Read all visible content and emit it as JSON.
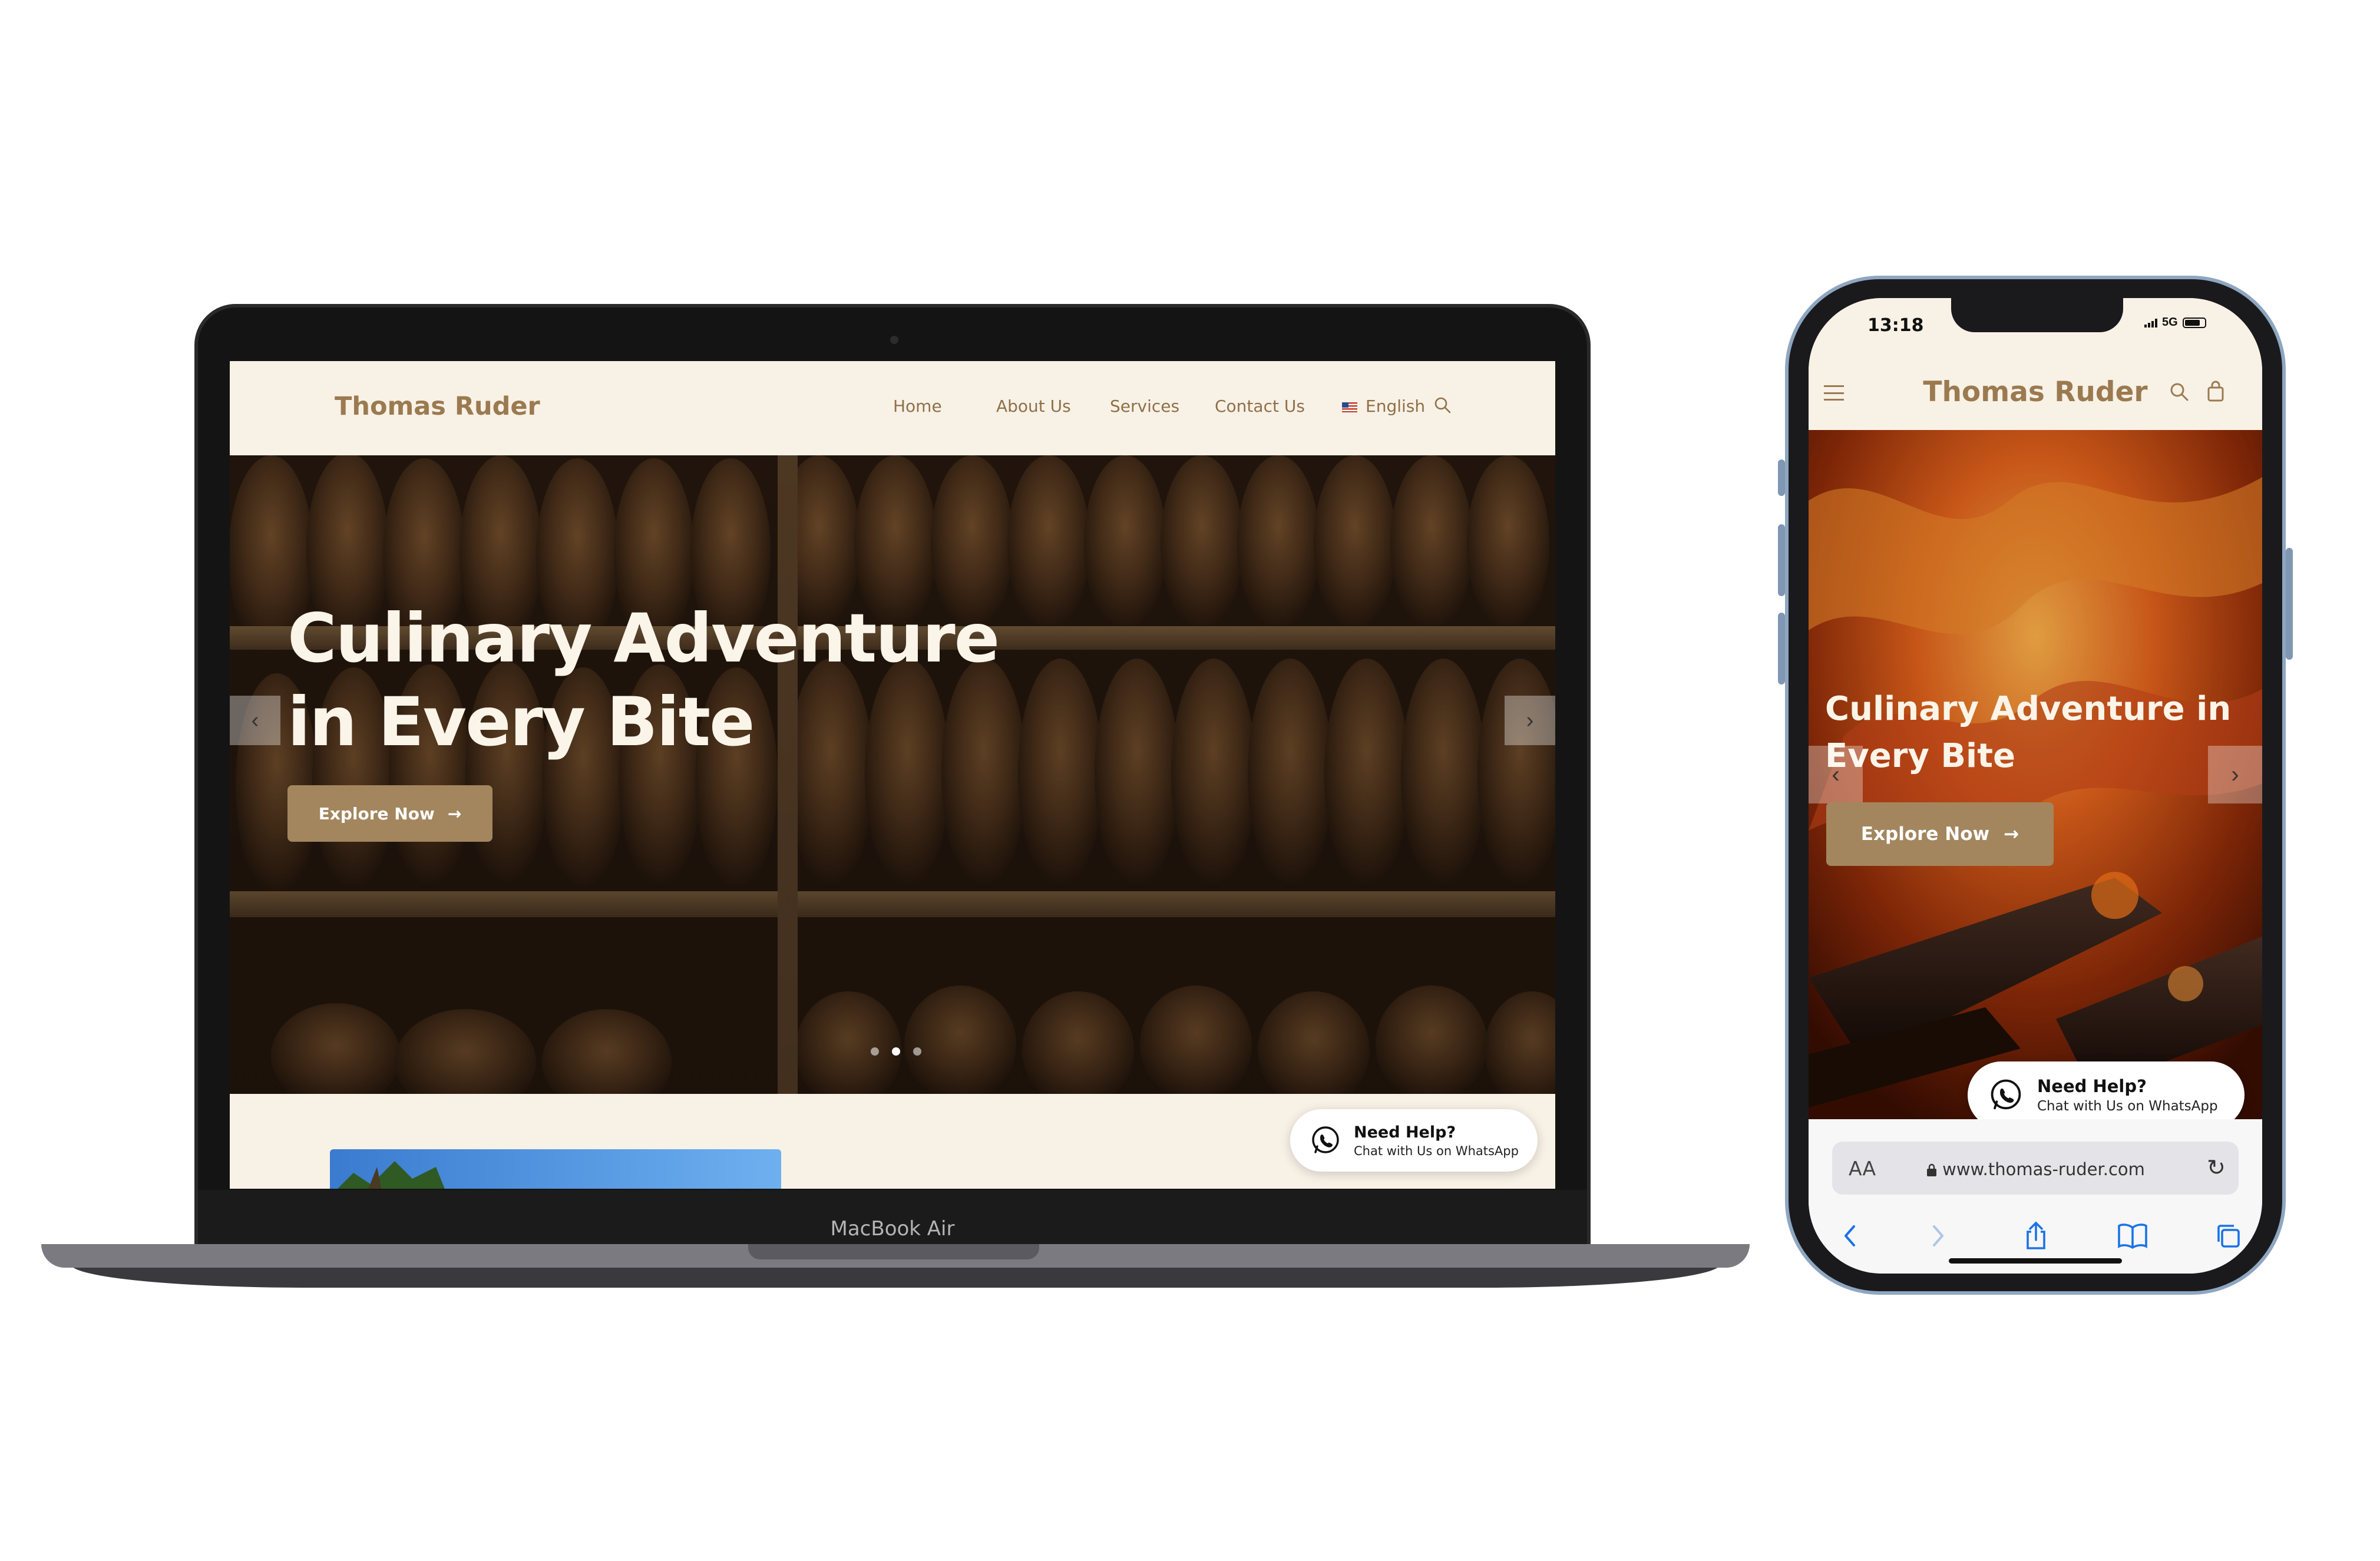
{
  "laptop": {
    "model_label": "MacBook Air",
    "site": {
      "logo": "Thomas Ruder",
      "nav": [
        "Home",
        "About Us",
        "Services",
        "Contact Us"
      ],
      "language": "English",
      "hero": {
        "title_line1": "Culinary Adventure",
        "title_line2": "in Every Bite",
        "cta": "Explore Now",
        "slides_total": 3,
        "active_slide": 2
      },
      "help": {
        "title": "Need Help?",
        "subtitle": "Chat with Us on WhatsApp"
      }
    }
  },
  "phone": {
    "status": {
      "time": "13:18",
      "network": "5G"
    },
    "site": {
      "logo": "Thomas Ruder",
      "hero": {
        "title_line1": "Culinary Adventure in",
        "title_line2": "Every Bite",
        "cta": "Explore Now"
      },
      "help": {
        "title": "Need Help?",
        "subtitle": "Chat with Us on WhatsApp"
      }
    },
    "browser": {
      "text_size_label": "AA",
      "url": "www.thomas-ruder.com"
    }
  },
  "colors": {
    "accent_brown": "#a3865e",
    "logo_brown": "#9b7a50",
    "cream_bg": "#f8f1e6"
  },
  "icons": [
    "search-icon",
    "chevron-left-icon",
    "chevron-right-icon",
    "arrow-right-icon",
    "whatsapp-icon",
    "hamburger-menu-icon",
    "shopping-bag-icon",
    "lock-icon",
    "reload-icon",
    "back-icon",
    "forward-icon",
    "share-icon",
    "bookmarks-icon",
    "tabs-icon",
    "us-flag-icon"
  ]
}
